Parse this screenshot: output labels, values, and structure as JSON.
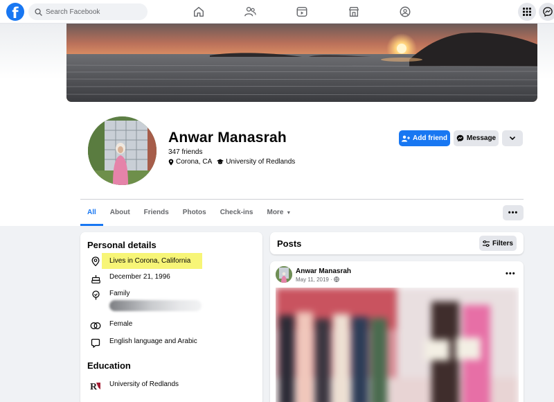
{
  "topbar": {
    "logo": "f",
    "search_placeholder": "Search Facebook",
    "nav_icons": [
      "home-icon",
      "friends-icon",
      "watch-icon",
      "marketplace-icon",
      "groups-icon"
    ],
    "right_icons": [
      "menu-grid-icon",
      "messenger-icon"
    ]
  },
  "profile": {
    "name": "Anwar Manasrah",
    "friends": "347 friends",
    "location": "Corona, CA",
    "school": "University of Redlands",
    "add_friend_label": "Add friend",
    "message_label": "Message"
  },
  "tabs": [
    {
      "label": "All",
      "active": true
    },
    {
      "label": "About"
    },
    {
      "label": "Friends"
    },
    {
      "label": "Photos"
    },
    {
      "label": "Check-ins"
    },
    {
      "label": "More"
    }
  ],
  "personal_details": {
    "title": "Personal details",
    "lives_in": "Lives in Corona, California",
    "birthday": "December 21, 1996",
    "family_label": "Family",
    "gender": "Female",
    "languages": "English language and Arabic"
  },
  "education": {
    "title": "Education",
    "school": "University of Redlands"
  },
  "posts": {
    "title": "Posts",
    "filters_label": "Filters",
    "items": [
      {
        "author": "Anwar Manasrah",
        "date": "May 11, 2019 · "
      }
    ]
  },
  "colors": {
    "brand": "#1877f2",
    "highlight": "#f7f577",
    "bg": "#f0f2f5"
  }
}
